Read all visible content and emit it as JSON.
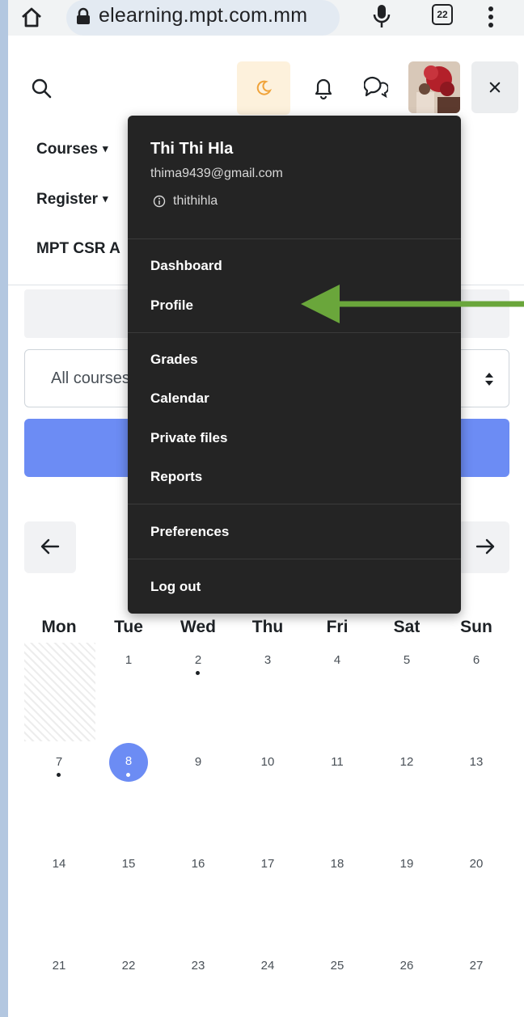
{
  "browser": {
    "url": "elearning.mpt.com.mm",
    "tab_count": "22"
  },
  "nav": {
    "courses": "Courses",
    "register": "Register",
    "mpt_csr": "MPT CSR A"
  },
  "course_filter": {
    "selected": "All courses"
  },
  "user_menu": {
    "name": "Thi Thi Hla",
    "email": "thima9439@gmail.com",
    "username": "thithihla",
    "items": [
      {
        "label": "Dashboard"
      },
      {
        "label": "Profile"
      },
      {
        "label": "Grades"
      },
      {
        "label": "Calendar"
      },
      {
        "label": "Private files"
      },
      {
        "label": "Reports"
      },
      {
        "label": "Preferences"
      },
      {
        "label": "Log out"
      }
    ]
  },
  "calendar": {
    "weekdays": [
      "Mon",
      "Tue",
      "Wed",
      "Thu",
      "Fri",
      "Sat",
      "Sun"
    ],
    "weeks": [
      [
        "",
        "1",
        "2",
        "3",
        "4",
        "5",
        "6"
      ],
      [
        "7",
        "8",
        "9",
        "10",
        "11",
        "12",
        "13"
      ],
      [
        "14",
        "15",
        "16",
        "17",
        "18",
        "19",
        "20"
      ],
      [
        "21",
        "22",
        "23",
        "24",
        "25",
        "26",
        "27"
      ]
    ],
    "today": "8",
    "days_with_events": [
      "2",
      "7",
      "8"
    ]
  },
  "colors": {
    "accent": "#6c8cf4",
    "menu_bg": "#242424",
    "annotation_arrow": "#6aa63b"
  },
  "icons": [
    "home-icon",
    "lock-icon",
    "mic-icon",
    "tabs-icon",
    "kebab-icon",
    "search-icon",
    "moon-icon",
    "bell-icon",
    "chat-icon",
    "close-icon",
    "info-icon",
    "arrow-left-icon",
    "arrow-right-icon"
  ]
}
